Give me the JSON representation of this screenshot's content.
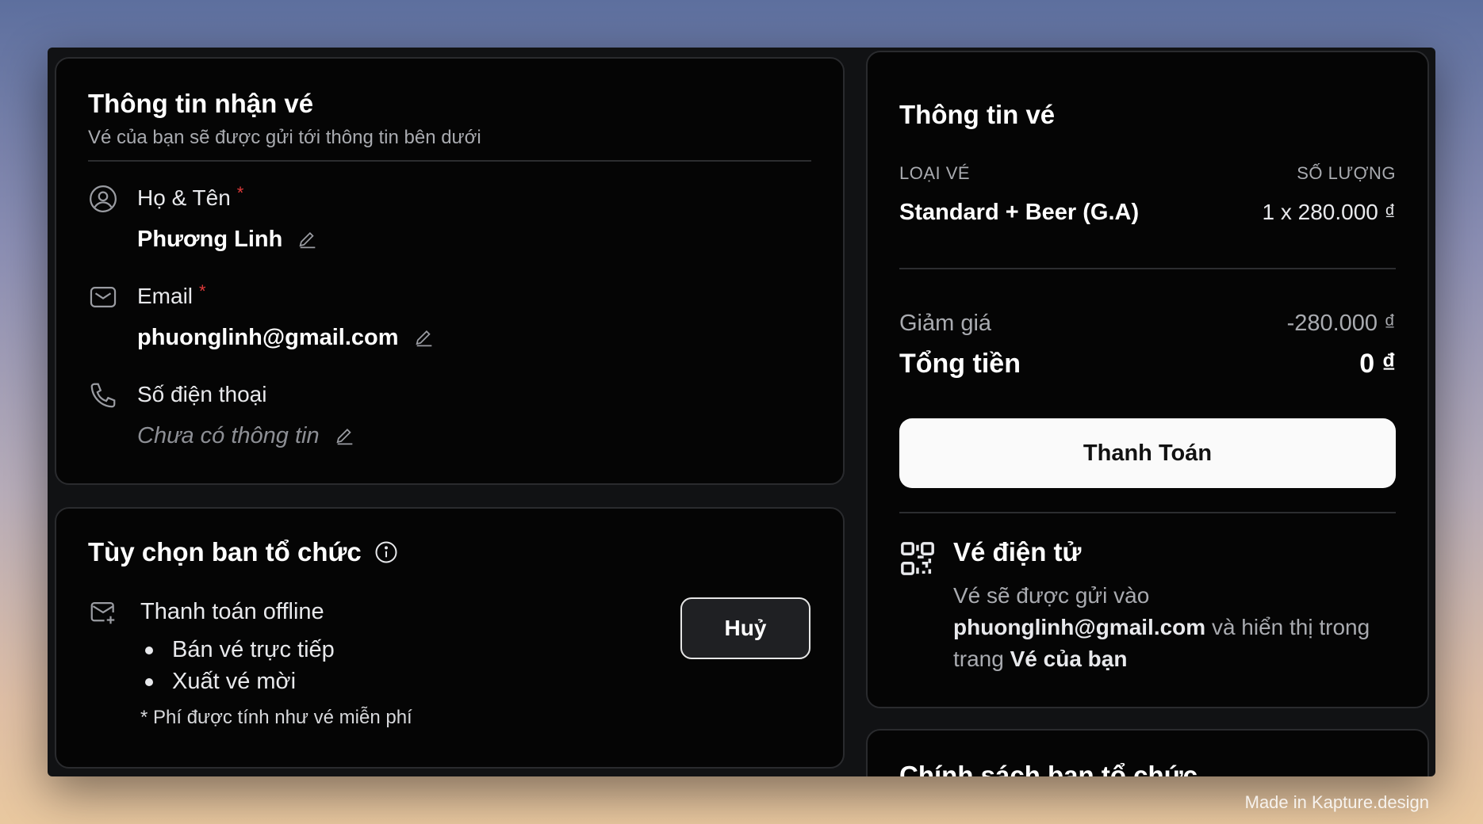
{
  "receive": {
    "title": "Thông tin nhận vé",
    "subtitle": "Vé của bạn sẽ được gửi tới thông tin bên dưới",
    "fields": [
      {
        "icon": "user-circle-icon",
        "label": "Họ & Tên",
        "required_mark": "*",
        "value": "Phương Linh"
      },
      {
        "icon": "mail-icon",
        "label": "Email",
        "required_mark": "*",
        "value": "phuonglinh@gmail.com"
      },
      {
        "icon": "phone-icon",
        "label": "Số điện thoại",
        "required_mark": "",
        "value": "Chưa có thông tin"
      }
    ]
  },
  "organizer": {
    "title": "Tùy chọn ban tổ chức",
    "option_title": "Thanh toán offline",
    "items": [
      "Bán vé trực tiếp",
      "Xuất vé mời"
    ],
    "note": "* Phí được tính như vé miễn phí",
    "cancel_label": "Huỷ"
  },
  "ticket": {
    "title": "Thông tin vé",
    "col_type": "LOẠI VÉ",
    "col_qty": "SỐ LƯỢNG",
    "item_name": "Standard + Beer (G.A)",
    "item_price": "1 x 280.000 ₫",
    "discount_label": "Giảm giá",
    "discount_value": "-280.000 ₫",
    "total_label": "Tổng tiền",
    "total_value": "0 ₫",
    "pay_label": "Thanh Toán",
    "eticket_title": "Vé điện tử",
    "eticket_line1": "Vé sẽ được gửi vào",
    "eticket_email": "phuonglinh@gmail.com",
    "eticket_line2": "và hiển thị trong trang",
    "eticket_page": "Vé của bạn"
  },
  "policy": {
    "title": "Chính sách ban tổ chức"
  },
  "watermark": "Made in Kapture.design"
}
